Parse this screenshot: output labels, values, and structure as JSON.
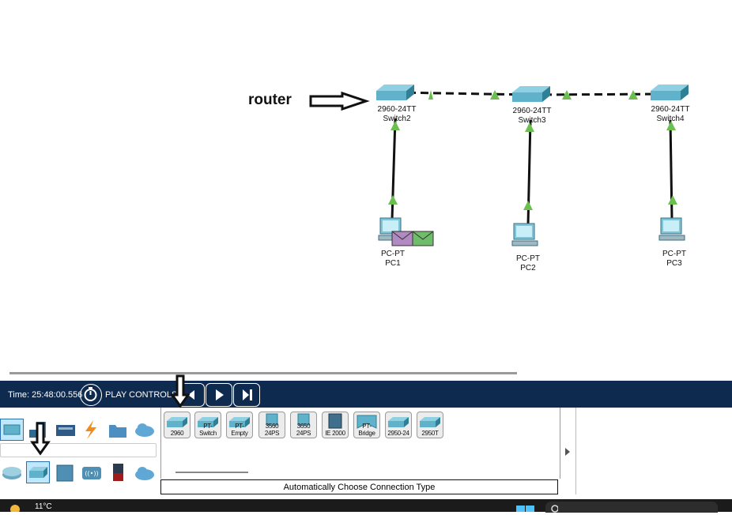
{
  "canvas": {
    "annotation_text": "router",
    "devices": [
      {
        "id": "switch2",
        "model": "2960-24TT",
        "name": "Switch2"
      },
      {
        "id": "switch3",
        "model": "2960-24TT",
        "name": "Switch3"
      },
      {
        "id": "switch4",
        "model": "2960-24TT",
        "name": "Switch4"
      },
      {
        "id": "pc1",
        "model": "PC-PT",
        "name": "PC1"
      },
      {
        "id": "pc2",
        "model": "PC-PT",
        "name": "PC2"
      },
      {
        "id": "pc3",
        "model": "PC-PT",
        "name": "PC3"
      }
    ],
    "link_status_color": "#6bbf4e"
  },
  "playbar": {
    "time_label": "Time: 25:48:00.556",
    "play_controls_label": "PLAY CONTROLS"
  },
  "device_tiles": [
    "2960",
    "PT-Switch",
    "PT-Empty",
    "3560 24PS",
    "3650 24PS",
    "IE 2000",
    "PT-Bridge",
    "2950-24",
    "2950T"
  ],
  "connection_type_label": "Automatically Choose Connection Type",
  "taskbar": {
    "temperature": "11°C"
  },
  "colors": {
    "switch_top": "#5fb2c9",
    "switch_side": "#2f7f97",
    "playbar_bg": "#0f2a4f",
    "link": "#111111"
  }
}
